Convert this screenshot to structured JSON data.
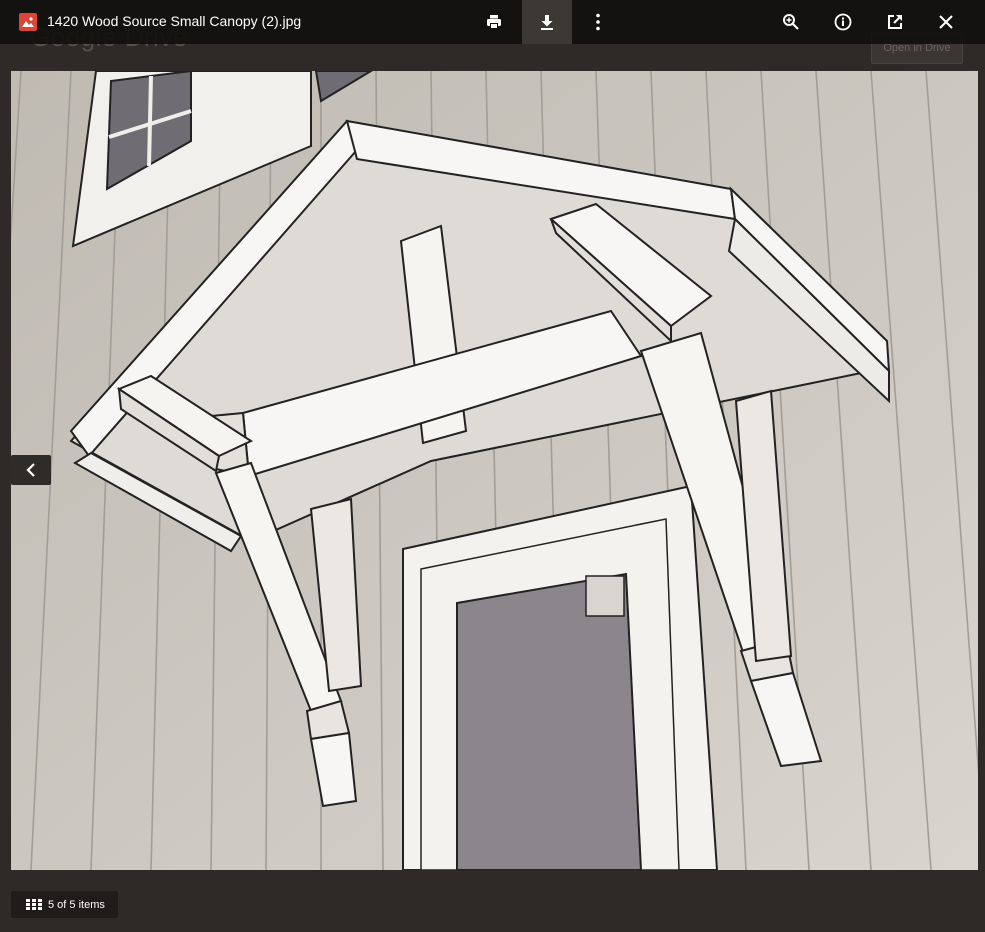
{
  "background": {
    "logo_text": "Google Drive",
    "open_button_label": "Open in Drive"
  },
  "topbar": {
    "file_icon": "image-file-icon",
    "title": "1420 Wood Source Small Canopy (2).jpg",
    "actions": [
      {
        "name": "print-icon"
      },
      {
        "name": "download-icon"
      },
      {
        "name": "more-options-icon"
      },
      {
        "name": "zoom-in-icon"
      },
      {
        "name": "info-icon"
      },
      {
        "name": "open-in-new-window-icon"
      },
      {
        "name": "close-icon"
      }
    ]
  },
  "navigation": {
    "prev_icon": "chevron-left-icon"
  },
  "footer": {
    "grid_icon": "grid-icon",
    "count_label": "5 of 5 items"
  },
  "colors": {
    "accent_red": "#db4437",
    "topbar": "#121010",
    "backdrop": "#2f2a28",
    "active_button": "#3c3836"
  }
}
